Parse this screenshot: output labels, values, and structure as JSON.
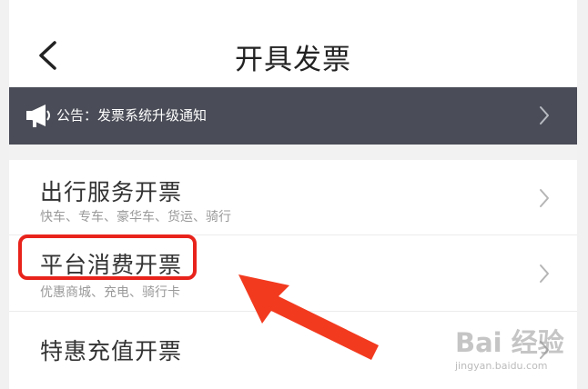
{
  "nav": {
    "title": "开具发票"
  },
  "notice": {
    "text": "公告：发票系统升级通知"
  },
  "items": [
    {
      "title": "出行服务开票",
      "subtitle": "快车、专车、豪华车、货运、骑行"
    },
    {
      "title": "平台消费开票",
      "subtitle": "优惠商城、充电、骑行卡"
    },
    {
      "title": "特惠充值开票",
      "subtitle": ""
    }
  ],
  "watermark": {
    "logo": "Bai 经验",
    "url": "jingyan.baidu.com"
  },
  "colors": {
    "notice_bg": "#4a4c57",
    "highlight": "#e8231c",
    "arrow": "#f23a1f"
  },
  "icons": {
    "back": "chevron-left-icon",
    "notice": "megaphone-icon",
    "row": "chevron-right-icon"
  }
}
